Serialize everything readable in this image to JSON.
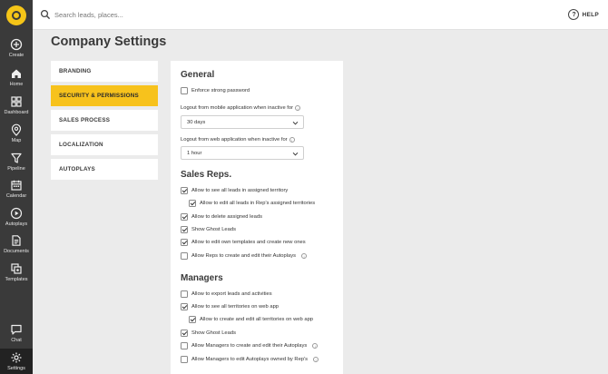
{
  "nav": {
    "items": [
      {
        "label": "Create",
        "icon": "plus-circle-icon"
      },
      {
        "label": "Home",
        "icon": "home-icon"
      },
      {
        "label": "Dashboard",
        "icon": "dashboard-icon"
      },
      {
        "label": "Map",
        "icon": "map-pin-icon"
      },
      {
        "label": "Pipeline",
        "icon": "funnel-icon"
      },
      {
        "label": "Calendar",
        "icon": "calendar-icon"
      },
      {
        "label": "Autoplays",
        "icon": "play-circle-icon"
      },
      {
        "label": "Documents",
        "icon": "document-icon"
      },
      {
        "label": "Templates",
        "icon": "templates-icon"
      },
      {
        "label": "Chat",
        "icon": "chat-icon"
      },
      {
        "label": "Settings",
        "icon": "gear-icon"
      }
    ],
    "brand_color": "#f5c518"
  },
  "topbar": {
    "search_placeholder": "Search leads, places...",
    "help_label": "HELP"
  },
  "page": {
    "title": "Company Settings"
  },
  "tabs": [
    {
      "label": "BRANDING",
      "active": false
    },
    {
      "label": "SECURITY & PERMISSIONS",
      "active": true
    },
    {
      "label": "SALES PROCESS",
      "active": false
    },
    {
      "label": "LOCALIZATION",
      "active": false
    },
    {
      "label": "AUTOPLAYS",
      "active": false
    }
  ],
  "accent_color": "#f7c21c",
  "general": {
    "title": "General",
    "enforce_password": {
      "label": "Enforce strong password",
      "checked": false
    },
    "mobile_logout": {
      "label": "Logout from mobile application when inactive for",
      "value": "30 days"
    },
    "web_logout": {
      "label": "Logout from web application when inactive for",
      "value": "1 hour"
    }
  },
  "sales_reps": {
    "title": "Sales Reps.",
    "options": [
      {
        "label": "Allow to see all leads in assigned territory",
        "checked": true
      },
      {
        "label": "Allow to edit all leads in Rep's assigned territories",
        "checked": true
      },
      {
        "label": "Allow to delete assigned leads",
        "checked": true
      },
      {
        "label": "Show Ghost Leads",
        "checked": true
      },
      {
        "label": "Allow to edit own templates and create new ones",
        "checked": true
      },
      {
        "label": "Allow Reps to create and edit their Autoplays",
        "checked": false
      }
    ]
  },
  "managers": {
    "title": "Managers",
    "options": [
      {
        "label": "Allow to export leads and activities",
        "checked": false
      },
      {
        "label": "Allow to see all territories on web app",
        "checked": true
      },
      {
        "label": "Allow to create and edit all territories on web app",
        "checked": true
      },
      {
        "label": "Show Ghost Leads",
        "checked": true
      },
      {
        "label": "Allow Managers to create and edit their Autoplays",
        "checked": false
      },
      {
        "label": "Allow Managers to edit Autoplays owned by Rep's",
        "checked": false
      }
    ]
  }
}
